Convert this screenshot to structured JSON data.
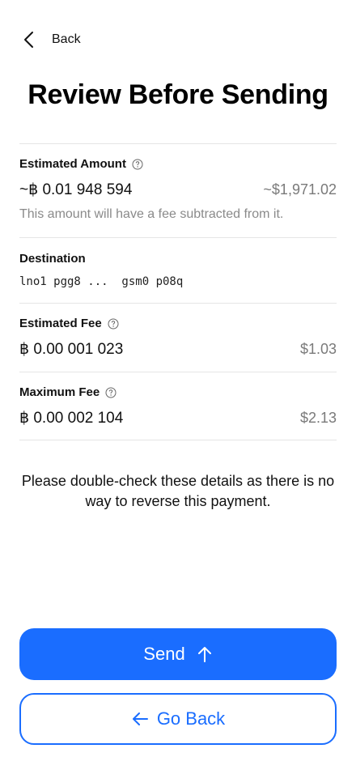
{
  "nav": {
    "back_label": "Back"
  },
  "title": "Review Before Sending",
  "estimated_amount": {
    "label": "Estimated Amount",
    "btc": "~฿ 0.01 948 594",
    "usd": "~$1,971.02",
    "note": "This amount will have a fee subtracted from it."
  },
  "destination": {
    "label": "Destination",
    "value": "lno1 pgg8 ...  gsm0 p08q"
  },
  "estimated_fee": {
    "label": "Estimated Fee",
    "btc": "฿ 0.00 001 023",
    "usd": "$1.03"
  },
  "maximum_fee": {
    "label": "Maximum Fee",
    "btc": "฿ 0.00 002 104",
    "usd": "$2.13"
  },
  "warning": "Please double-check these details as there is no way to reverse this payment.",
  "actions": {
    "send_label": "Send",
    "go_back_label": "Go Back"
  },
  "colors": {
    "accent": "#1a6dff",
    "muted": "#8a8a8a",
    "divider": "#e5e5e5"
  },
  "icons": {
    "back": "chevron-left-icon",
    "help": "help-circle-icon",
    "send": "arrow-up-icon",
    "go_back": "arrow-left-icon"
  }
}
